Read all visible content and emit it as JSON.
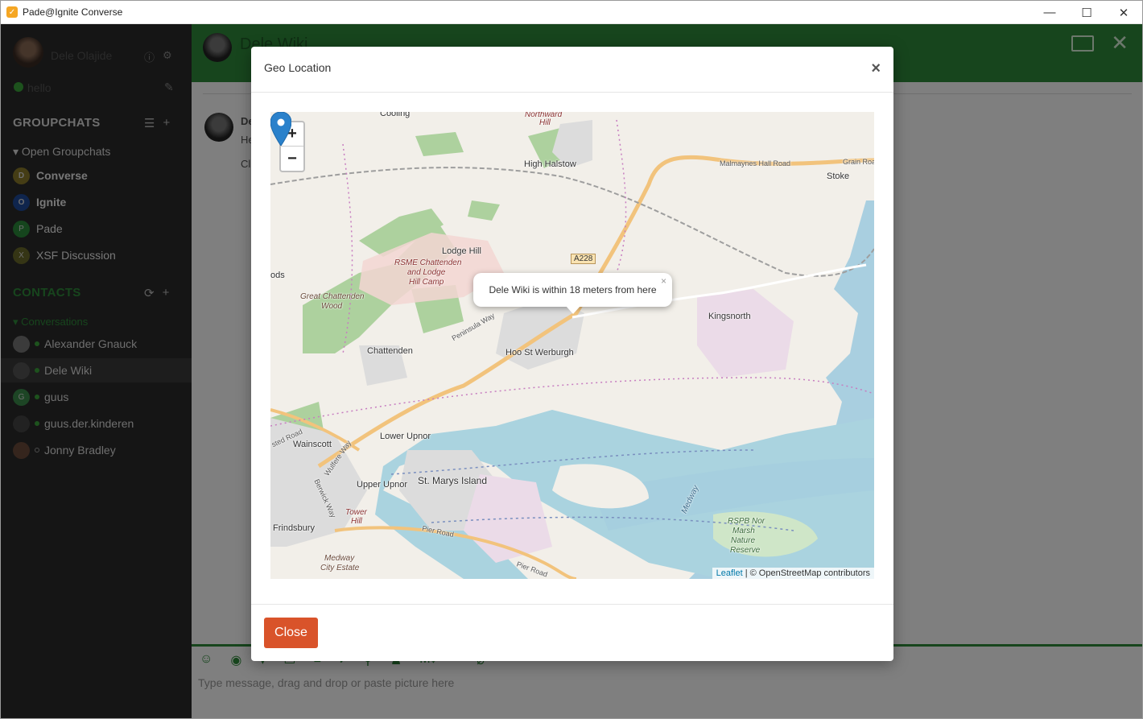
{
  "window": {
    "title": "Pade@Ignite Converse",
    "controls": [
      "—",
      "☐",
      "✕"
    ]
  },
  "sidebar": {
    "user_name": "Dele Olajide",
    "status": "hello",
    "groupchats_title": "GROUPCHATS",
    "open_groupchats_label": "Open Groupchats",
    "rooms": [
      {
        "initial": "D",
        "name": "Converse",
        "color": "#8a7a2a"
      },
      {
        "initial": "O",
        "name": "Ignite",
        "color": "#1e4a9a"
      },
      {
        "initial": "P",
        "name": "Pade",
        "color": "#2a8a3a"
      },
      {
        "initial": "X",
        "name": "XSF Discussion",
        "color": "#6a6a2a"
      }
    ],
    "contacts_title": "CONTACTS",
    "conversations_label": "Conversations",
    "contacts": [
      {
        "name": "Alexander Gnauck",
        "status": "online"
      },
      {
        "name": "Dele Wiki",
        "status": "online"
      },
      {
        "name": "guus",
        "initial": "G",
        "status": "online"
      },
      {
        "name": "guus.der.kinderen",
        "status": "online"
      },
      {
        "name": "Jonny Bradley",
        "status": "offline"
      }
    ]
  },
  "chat": {
    "title": "Dele Wiki",
    "message_sender": "De",
    "message_line1": "He",
    "message_line2": "Cl",
    "composer_placeholder": "Type message, drag and drop or paste picture here"
  },
  "modal": {
    "title": "Geo Location",
    "close_x": "×",
    "close_button": "Close",
    "map": {
      "zoom_in": "+",
      "zoom_out": "−",
      "popup_text": "Dele Wiki is within 18 meters from here",
      "popup_close": "×",
      "attribution_link": "Leaflet",
      "attribution_text": "| © OpenStreetMap contributors",
      "labels": {
        "cooling": "Cooling",
        "northward": "Northward",
        "hill": "Hill",
        "high_halstow": "High Halstow",
        "malmaynes": "Malmaynes Hall Road",
        "grain_road": "Grain Road",
        "stoke": "Stoke",
        "lodge_hill": "Lodge Hill",
        "a228": "A228",
        "rsme1": "RSME Chattenden",
        "rsme2": "and Lodge",
        "rsme3": "Hill Camp",
        "ods": "ods",
        "great_chattenden": "Great Chattenden",
        "wood": "Wood",
        "peninsula_way": "Peninsula Way",
        "kingsnorth": "Kingsnorth",
        "chattenden": "Chattenden",
        "hoo": "Hoo St Werburgh",
        "lower_upnor": "Lower Upnor",
        "wainscott": "Wainscott",
        "upper_upnor": "Upper Upnor",
        "st_marys": "St. Marys Island",
        "tower": "Tower",
        "tower_hill": "Hill",
        "frindsbury": "Frindsbury",
        "pier_road": "Pier Road",
        "pier_road2": "Pier Road",
        "medway_city1": "Medway",
        "medway_city2": "City Estate",
        "medway_river": "Medway",
        "rspb1": "RSPB Nor",
        "rspb2": "Marsh",
        "rspb3": "Nature",
        "rspb4": "Reserve",
        "wulfere": "Wulfere Way",
        "berwick": "Berwick Way",
        "sted_road": "sted Road"
      }
    }
  },
  "colors": {
    "accent_green": "#2e8b3a",
    "close_btn": "#d9532a",
    "marker": "#2a81cb"
  }
}
